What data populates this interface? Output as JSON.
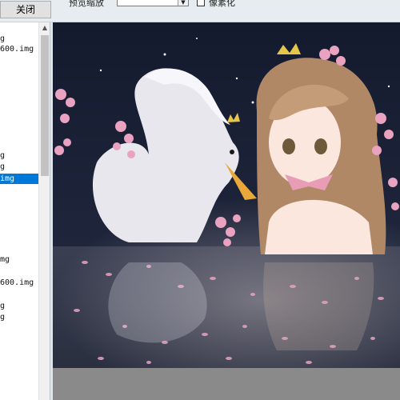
{
  "toolbar": {
    "close_label": "关闭",
    "scale_label": "预览缩放",
    "scale_value": "",
    "pixelated_label": "像素化"
  },
  "file_list": {
    "items": [
      {
        "label": "g"
      },
      {
        "label": "600.img"
      },
      {
        "label": "g"
      },
      {
        "label": "g"
      },
      {
        "label": "img",
        "selected": true
      },
      {
        "label": "mg"
      },
      {
        "label": "600.img"
      },
      {
        "label": "g"
      },
      {
        "label": "g"
      }
    ]
  },
  "colors": {
    "selection": "#0078d7",
    "scene_water": "#2f3446",
    "scene_sky": "#1a2238",
    "blossom": "#e9a3c1"
  },
  "icons": {
    "dropdown": "chevron-down-icon",
    "scroll_up": "arrow-up-icon"
  }
}
